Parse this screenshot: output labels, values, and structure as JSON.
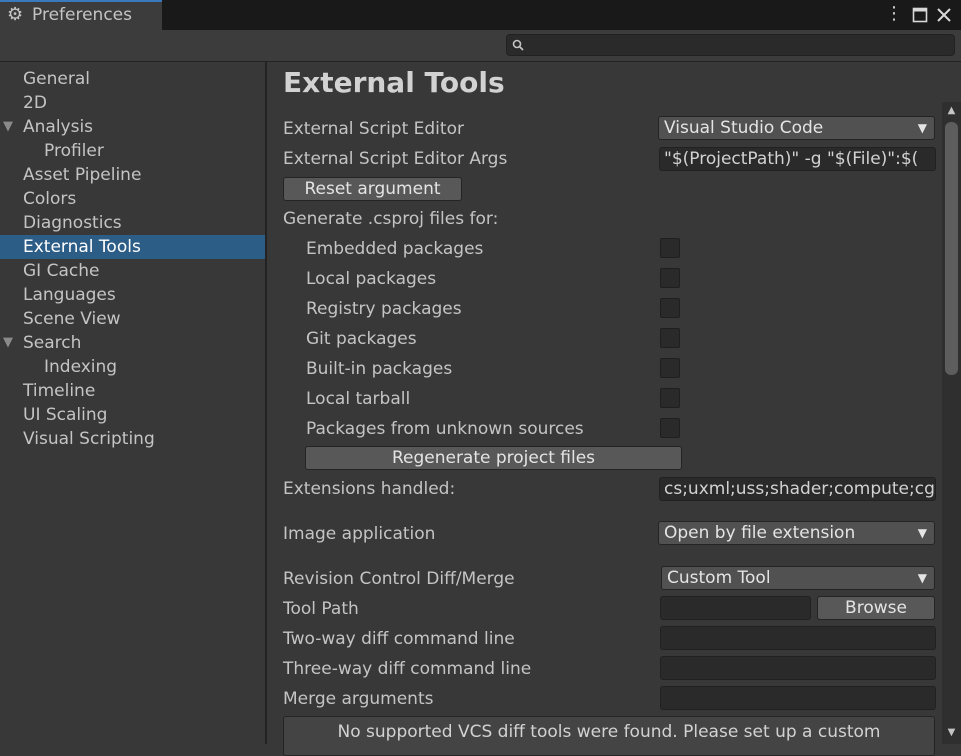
{
  "window": {
    "tab_title": "Preferences",
    "tab_icon": "gear-icon",
    "controls": {
      "menu_icon": "more-vert-icon",
      "maximize_icon": "maximize-icon",
      "close_icon": "close-icon"
    }
  },
  "search": {
    "icon": "search-icon",
    "placeholder": "",
    "value": ""
  },
  "sidebar": {
    "items": [
      {
        "label": "General"
      },
      {
        "label": "2D"
      },
      {
        "label": "Analysis",
        "expanded": true
      },
      {
        "label": "Profiler"
      },
      {
        "label": "Asset Pipeline"
      },
      {
        "label": "Colors"
      },
      {
        "label": "Diagnostics"
      },
      {
        "label": "External Tools",
        "selected": true
      },
      {
        "label": "GI Cache"
      },
      {
        "label": "Languages"
      },
      {
        "label": "Scene View"
      },
      {
        "label": "Search",
        "expanded": true
      },
      {
        "label": "Indexing"
      },
      {
        "label": "Timeline"
      },
      {
        "label": "UI Scaling"
      },
      {
        "label": "Visual Scripting"
      }
    ],
    "expand_glyph": "▼"
  },
  "main": {
    "title": "External Tools",
    "script_editor": {
      "label": "External Script Editor",
      "value": "Visual Studio Code"
    },
    "script_editor_args": {
      "label": "External Script Editor Args",
      "value": "\"$(ProjectPath)\" -g \"$(File)\":$("
    },
    "reset_button": "Reset argument",
    "generate_label": "Generate .csproj files for:",
    "packages": [
      {
        "label": "Embedded packages",
        "checked": false
      },
      {
        "label": "Local packages",
        "checked": false
      },
      {
        "label": "Registry packages",
        "checked": false
      },
      {
        "label": "Git packages",
        "checked": false
      },
      {
        "label": "Built-in packages",
        "checked": false
      },
      {
        "label": "Local tarball",
        "checked": false
      },
      {
        "label": "Packages from unknown sources",
        "checked": false
      }
    ],
    "regenerate_button": "Regenerate project files",
    "extensions": {
      "label": "Extensions handled:",
      "value": "cs;uxml;uss;shader;compute;cg"
    },
    "image_application": {
      "label": "Image application",
      "value": "Open by file extension"
    },
    "revision_control": {
      "label": "Revision Control Diff/Merge",
      "value": "Custom Tool"
    },
    "tool_path": {
      "label": "Tool Path",
      "value": "",
      "browse_button": "Browse"
    },
    "two_way": {
      "label": "Two-way diff command line",
      "value": ""
    },
    "three_way": {
      "label": "Three-way diff command line",
      "value": ""
    },
    "merge_args": {
      "label": "Merge arguments",
      "value": ""
    },
    "notice": "No supported VCS diff tools were found. Please set up a custom"
  },
  "colors": {
    "selection": "#2c5d87",
    "background": "#383838",
    "accent_tab": "#3a79bb"
  }
}
